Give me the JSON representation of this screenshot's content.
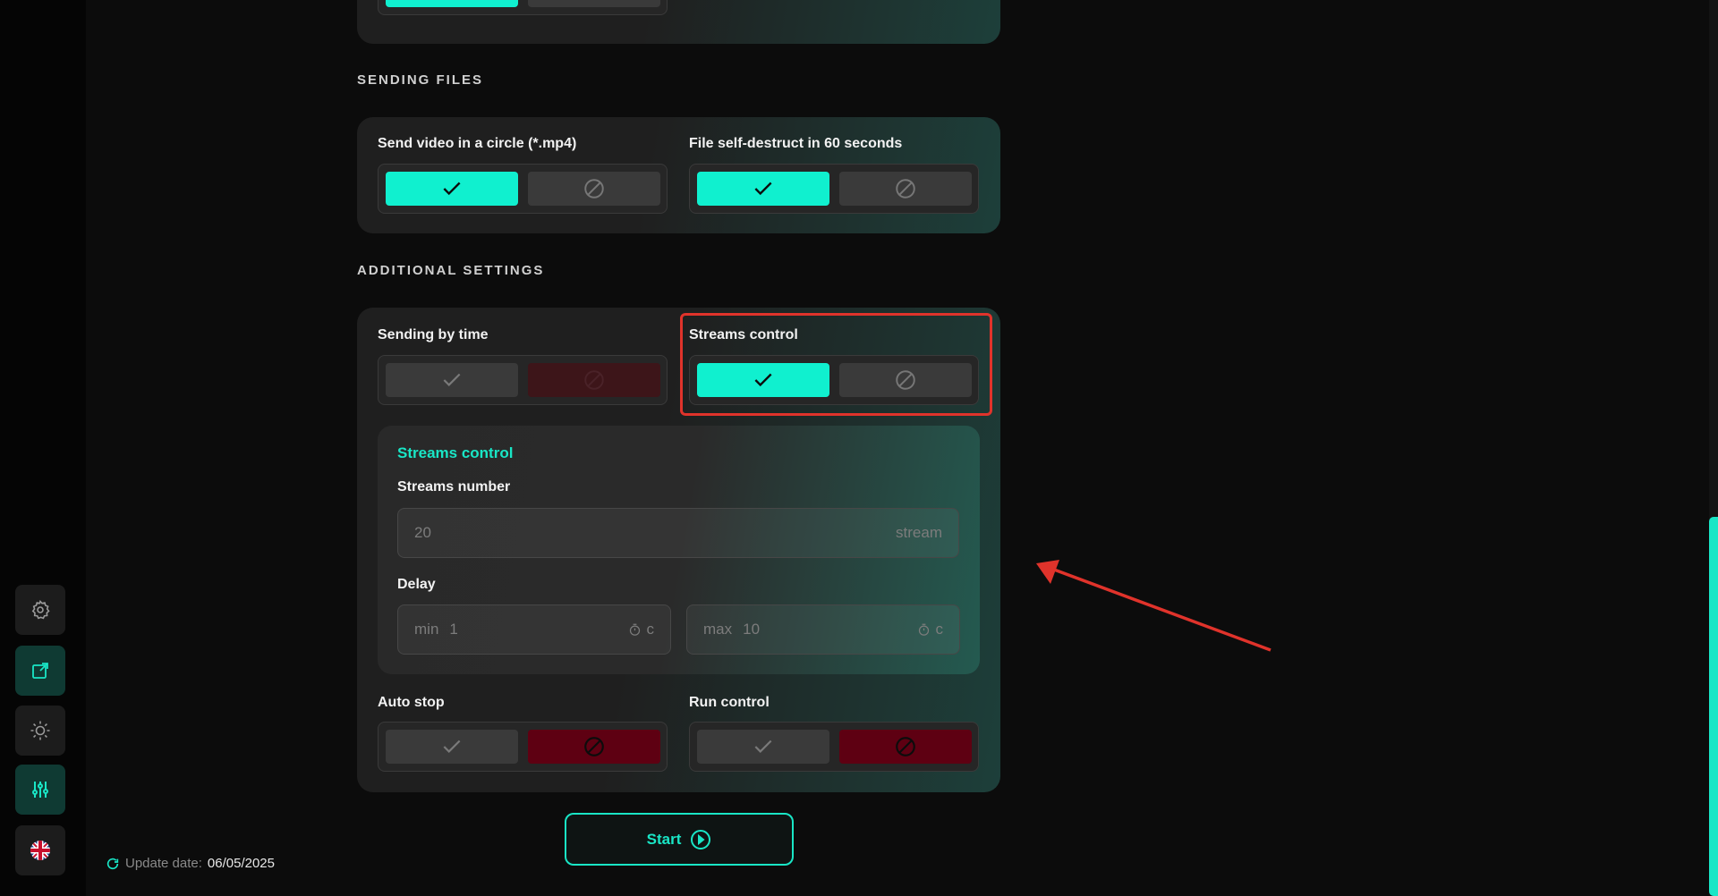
{
  "sections": {
    "sending_files": "SENDING FILES",
    "additional": "ADDITIONAL SETTINGS"
  },
  "fields": {
    "send_video_circle": "Send video in a circle (*.mp4)",
    "file_self_destruct": "File self-destruct in 60 seconds",
    "sending_by_time": "Sending by time",
    "streams_control": "Streams control",
    "auto_stop": "Auto stop",
    "run_control": "Run control"
  },
  "streams_panel": {
    "title": "Streams control",
    "streams_number_label": "Streams number",
    "streams_number_value": "20",
    "streams_number_unit": "stream",
    "delay_label": "Delay",
    "delay_min_prefix": "min",
    "delay_min_value": "1",
    "delay_max_prefix": "max",
    "delay_max_value": "10",
    "delay_unit": "c"
  },
  "start_label": "Start",
  "update": {
    "label": "Update date:",
    "value": "06/05/2025"
  },
  "colors": {
    "accent": "#10f0cf",
    "danger": "#5e0012",
    "highlight": "#e0332b"
  },
  "icons": [
    "gear-icon",
    "external-link-icon",
    "brightness-icon",
    "sliders-icon",
    "uk-flag-icon",
    "refresh-icon",
    "check-icon",
    "block-icon",
    "timer-icon",
    "play-circle-icon"
  ]
}
